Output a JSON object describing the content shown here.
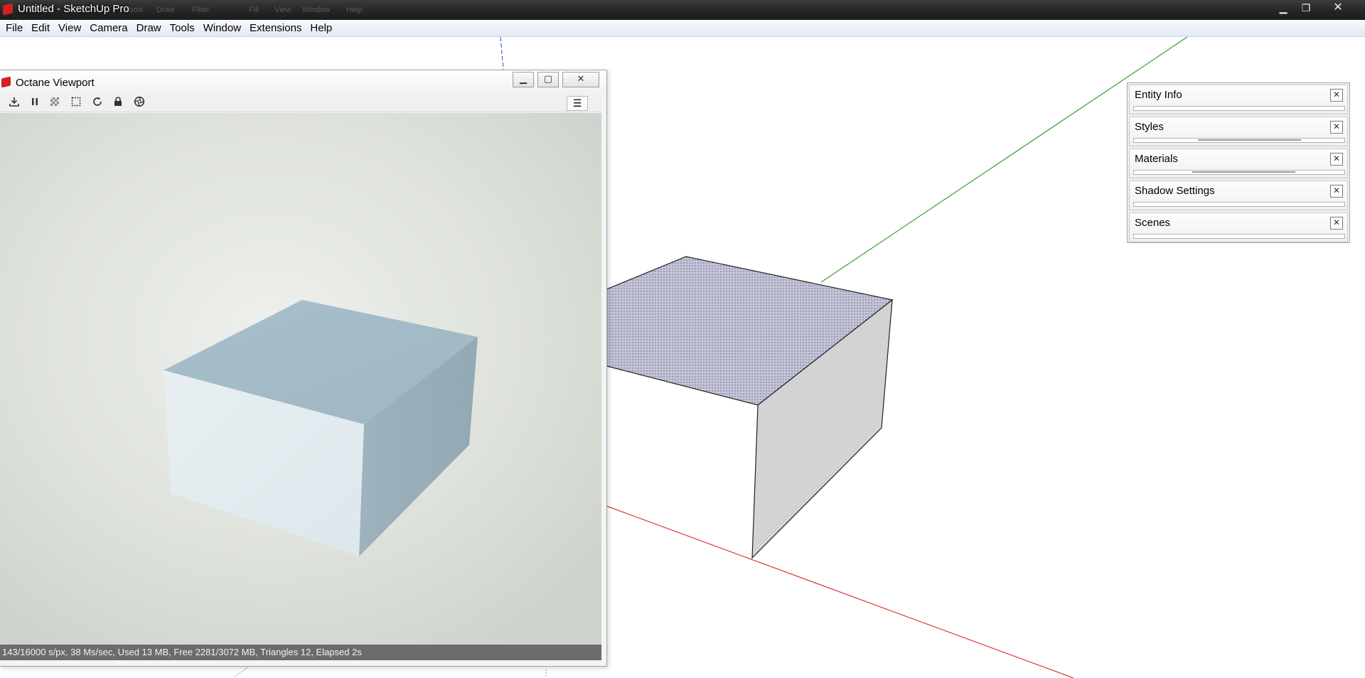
{
  "window": {
    "title": "Untitled - SketchUp Pro",
    "ghost_menu": [
      "Tools",
      "Draw",
      "Filter",
      "Fill",
      "View",
      "Window",
      "Help"
    ],
    "controls": {
      "minimize": "▁",
      "maximize": "❐",
      "close": "✕"
    }
  },
  "menubar": {
    "items": [
      "File",
      "Edit",
      "View",
      "Camera",
      "Draw",
      "Tools",
      "Window",
      "Extensions",
      "Help"
    ]
  },
  "octane": {
    "title": "Octane Viewport",
    "controls": {
      "minimize": "▁",
      "maximize": "▢",
      "close": "✕"
    },
    "toolbar_icons": [
      "save-icon",
      "pause-icon",
      "grid-icon",
      "region-select-icon",
      "refresh-icon",
      "lock-icon",
      "aperture-icon"
    ],
    "menu_label": "☰",
    "status": "143/16000 s/px, 38 Ms/sec, Used 13 MB, Free 2281/3072 MB, Triangles 12, Elapsed 2s"
  },
  "trays": {
    "items": [
      {
        "title": "Entity Info",
        "close": "✕"
      },
      {
        "title": "Styles",
        "close": "✕"
      },
      {
        "title": "Materials",
        "close": "✕"
      },
      {
        "title": "Shadow Settings",
        "close": "✕"
      },
      {
        "title": "Scenes",
        "close": "✕"
      }
    ]
  },
  "colors": {
    "axis_green": "#2ea22e",
    "axis_red": "#d83a3a",
    "axis_blue": "#3a3ad8",
    "box_top": "#b9b9d2",
    "box_side": "#d3d3d3",
    "render_top": "#a9bfcc",
    "render_front": "#e2ebef",
    "render_side": "#98aeb8",
    "statusbar": "#6b6b6b"
  }
}
